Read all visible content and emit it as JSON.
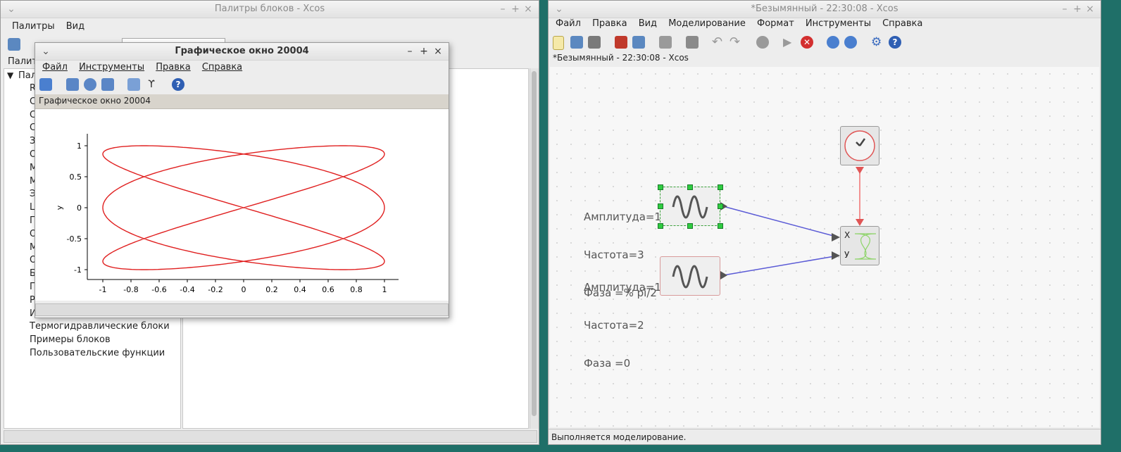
{
  "palette_window": {
    "title": "Палитры блоков - Xcos",
    "menu": [
      "Палитры",
      "Вид"
    ],
    "tab_label": "Палитр",
    "tree_root": "Пали",
    "tree_items": [
      "R",
      "С",
      "С",
      "С",
      "З",
      "О",
      "М",
      "М",
      "Э",
      "Ц",
      "П",
      "О",
      "М",
      "О",
      "Б",
      "П",
      "Р",
      "И"
    ],
    "tree_items_full": [
      "Термогидравлические блоки",
      "Примеры блоков",
      "Пользовательские функции"
    ]
  },
  "graphic_window": {
    "title": "Графическое окно 20004",
    "menu": [
      "Файл",
      "Инструменты",
      "Правка",
      "Справка"
    ],
    "label": "Графическое окно 20004"
  },
  "xcos_window": {
    "title": "*Безымянный - 22:30:08 - Xcos",
    "menu": [
      "Файл",
      "Правка",
      "Вид",
      "Моделирование",
      "Формат",
      "Инструменты",
      "Справка"
    ],
    "tab_label": "*Безымянный - 22:30:08 - Xcos",
    "status": "Выполняется моделирование.",
    "block1": {
      "amp": "Амплитуда=1",
      "freq": "Частота=3",
      "phase": "Фаза =% pi/2"
    },
    "block2": {
      "amp": "Амплитуда=1",
      "freq": "Частота=2",
      "phase": "Фаза =0"
    },
    "port_x": "X",
    "port_y": "У"
  },
  "chart_data": {
    "type": "line",
    "title": "",
    "xlabel": "",
    "ylabel": "y",
    "xlim": [
      -1,
      1
    ],
    "ylim": [
      -1,
      1
    ],
    "x_ticks": [
      "-1",
      "-0.8",
      "-0.6",
      "-0.4",
      "-0.2",
      "0",
      "0.2",
      "0.4",
      "0.6",
      "0.8",
      "1"
    ],
    "y_ticks": [
      "1",
      "0.5",
      "0",
      "-0.5",
      "-1"
    ],
    "series": [
      {
        "x_formula": "sin(3t + pi/2)",
        "y_formula": "sin(2t)",
        "color": "#e02020"
      }
    ]
  },
  "colors": {
    "desktop": "#1f6f68",
    "curve": "#e02020",
    "link": "#5b5bd6",
    "clock_link": "#f07070"
  }
}
